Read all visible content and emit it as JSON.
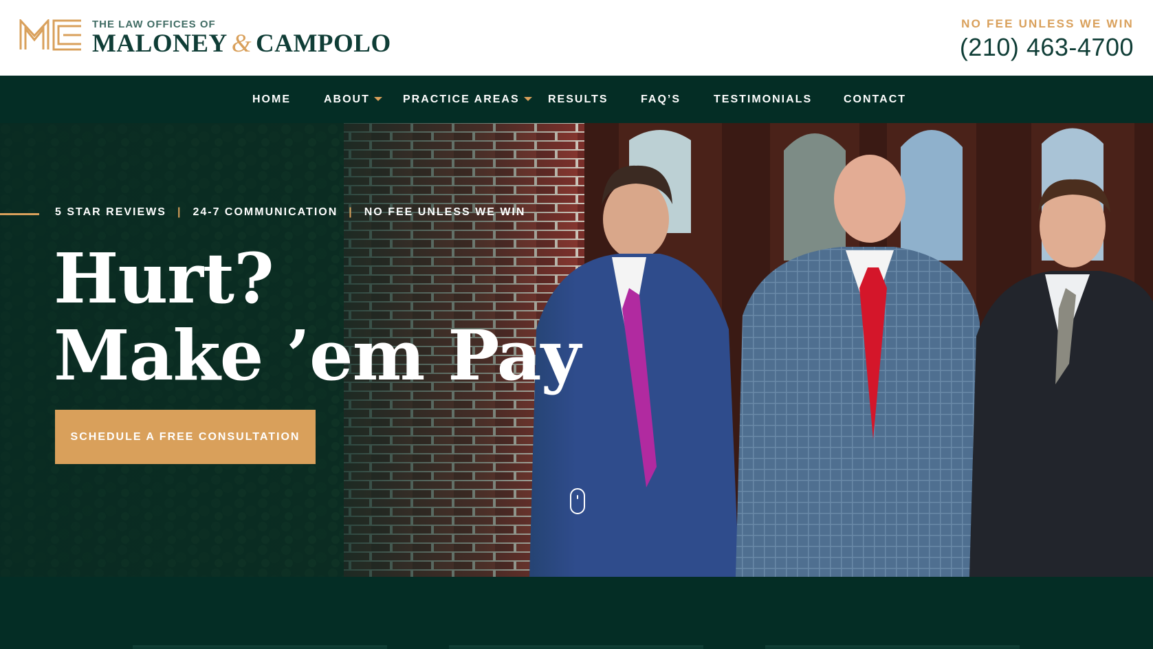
{
  "header": {
    "logo": {
      "small_text": "THE LAW  OFFICES OF",
      "name_left": "MALONEY",
      "ampersand": "&",
      "name_right": "CAMPOLO",
      "icon": "mc-monogram-logo"
    },
    "fee_tagline": "NO FEE UNLESS WE WIN",
    "phone": "(210) 463-4700"
  },
  "nav": {
    "items": [
      {
        "label": "HOME",
        "has_dropdown": false
      },
      {
        "label": "ABOUT",
        "has_dropdown": true
      },
      {
        "label": "PRACTICE AREAS",
        "has_dropdown": true
      },
      {
        "label": "RESULTS",
        "has_dropdown": false
      },
      {
        "label": "FAQ’S",
        "has_dropdown": false
      },
      {
        "label": "TESTIMONIALS",
        "has_dropdown": false
      },
      {
        "label": "CONTACT",
        "has_dropdown": false
      }
    ]
  },
  "hero": {
    "taglines": [
      "5 STAR REVIEWS",
      "24-7 COMMUNICATION",
      "NO FEE UNLESS WE WIN"
    ],
    "separator": "|",
    "title_line1": "Hurt?",
    "title_line2": "Make ’em Pay",
    "cta_label": "SCHEDULE A FREE CONSULTATION",
    "scroll_icon": "mouse-scroll-icon",
    "background_image": "three-attorneys-in-suits-photo"
  },
  "colors": {
    "brand_green": "#042d25",
    "accent_gold": "#d9a05b",
    "text_dark_green": "#0f3d36",
    "white": "#ffffff"
  }
}
